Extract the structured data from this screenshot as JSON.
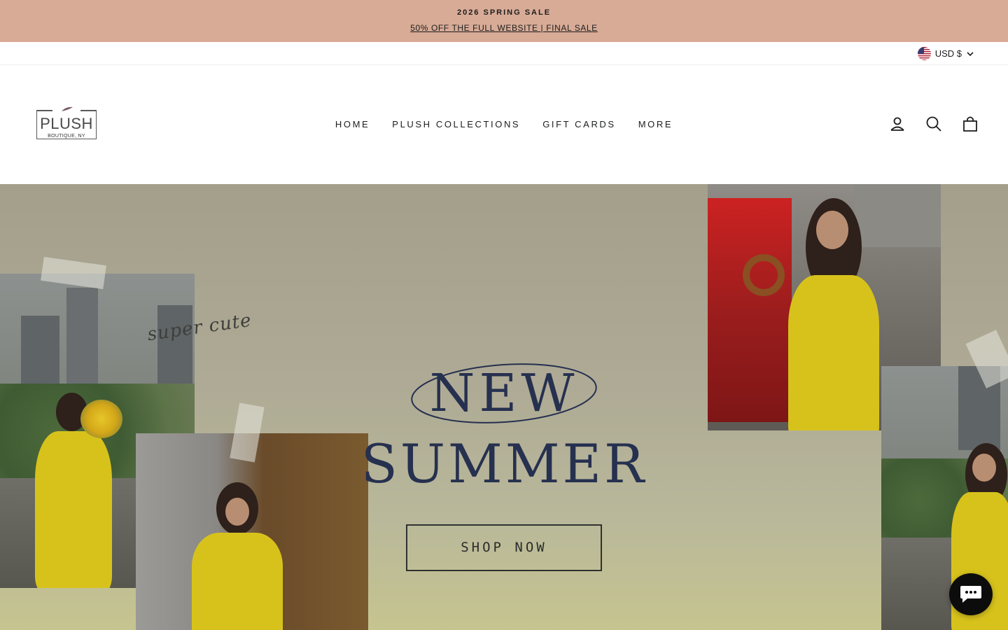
{
  "announcement": {
    "title": "2026 SPRING SALE",
    "link_text": "50% OFF THE FULL WEBSITE | FINAL SALE"
  },
  "utility": {
    "currency": "USD $",
    "currency_flag": "us-flag-icon"
  },
  "header": {
    "logo_word": "PLUSH",
    "logo_sub": "BOUTIQUE, NY",
    "nav": [
      {
        "label": "HOME"
      },
      {
        "label": "PLUSH COLLECTIONS"
      },
      {
        "label": "GIFT CARDS"
      },
      {
        "label": "MORE"
      }
    ],
    "icons": [
      "user-icon",
      "search-icon",
      "cart-icon"
    ]
  },
  "hero": {
    "script_text": "super cute",
    "title_line1": "NEW",
    "title_line2": "SUMMER",
    "cta_label": "SHOP NOW"
  },
  "chat": {
    "icon": "chat-bubble-icon"
  },
  "colors": {
    "announcement_bg": "#d8ab96",
    "title_navy": "#26304f",
    "outfit_yellow": "#d7c21c"
  }
}
